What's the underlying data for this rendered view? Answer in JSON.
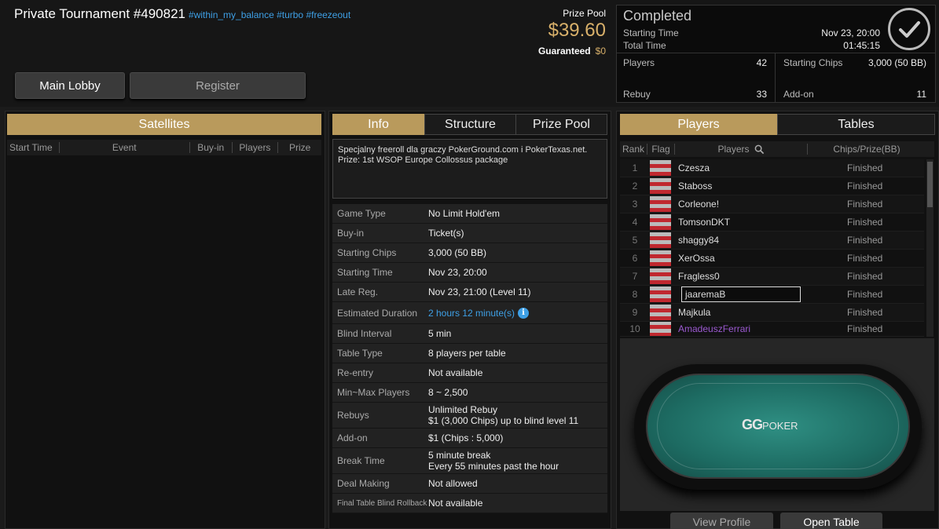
{
  "header": {
    "title": "Private Tournament #490821",
    "tags": "#within_my_balance #turbo #freezeout",
    "prize_pool_label": "Prize Pool",
    "prize_pool_value": "$39.60",
    "guaranteed_label": "Guaranteed",
    "guaranteed_value": "$0",
    "main_lobby_label": "Main Lobby",
    "register_label": "Register"
  },
  "status": {
    "state": "Completed",
    "starting_time_label": "Starting Time",
    "starting_time_value": "Nov 23, 20:00",
    "total_time_label": "Total Time",
    "total_time_value": "01:45:15",
    "players_label": "Players",
    "players_value": "42",
    "rebuy_label": "Rebuy",
    "rebuy_value": "33",
    "starting_chips_label": "Starting Chips",
    "starting_chips_value": "3,000 (50 BB)",
    "addon_label": "Add-on",
    "addon_value": "11"
  },
  "satellites": {
    "tab": "Satellites",
    "columns": [
      "Start Time",
      "Event",
      "Buy-in",
      "Players",
      "Prize"
    ]
  },
  "info_panel": {
    "tabs": [
      "Info",
      "Structure",
      "Prize Pool"
    ],
    "description": "Specjalny freeroll dla graczy PokerGround.com i PokerTexas.net.\nPrize: 1st WSOP Europe Collossus package",
    "rows": [
      {
        "k": "Game Type",
        "v": "No Limit Hold'em"
      },
      {
        "k": "Buy-in",
        "v": "Ticket(s)"
      },
      {
        "k": "Starting Chips",
        "v": "3,000 (50 BB)"
      },
      {
        "k": "Starting Time",
        "v": "Nov 23, 20:00"
      },
      {
        "k": "Late Reg.",
        "v": "Nov 23, 21:00 (Level 11)"
      },
      {
        "k": "Estimated Duration",
        "v": "2 hours 12 minute(s)"
      },
      {
        "k": "Blind Interval",
        "v": "5 min"
      },
      {
        "k": "Table Type",
        "v": "8 players per table"
      },
      {
        "k": "Re-entry",
        "v": "Not available"
      },
      {
        "k": "Min~Max Players",
        "v": "8 ~ 2,500"
      },
      {
        "k": "Rebuys",
        "v": "Unlimited Rebuy\n$1 (3,000 Chips) up to blind level 11"
      },
      {
        "k": "Add-on",
        "v": "$1 (Chips : 5,000)"
      },
      {
        "k": "Break Time",
        "v": "5 minute break\nEvery 55 minutes past the hour"
      },
      {
        "k": "Deal Making",
        "v": "Not allowed"
      },
      {
        "k": "Final Table Blind Rollback",
        "v": "Not available"
      }
    ]
  },
  "players_panel": {
    "tabs": [
      "Players",
      "Tables"
    ],
    "columns": [
      "Rank",
      "Flag",
      "Players",
      "Chips/Prize(BB)"
    ],
    "rows": [
      {
        "rank": "1",
        "name": "Czesza",
        "status": "Finished"
      },
      {
        "rank": "2",
        "name": "Staboss",
        "status": "Finished"
      },
      {
        "rank": "3",
        "name": "Corleone!",
        "status": "Finished"
      },
      {
        "rank": "4",
        "name": "TomsonDKT",
        "status": "Finished"
      },
      {
        "rank": "5",
        "name": "shaggy84",
        "status": "Finished"
      },
      {
        "rank": "6",
        "name": "XerOssa",
        "status": "Finished"
      },
      {
        "rank": "7",
        "name": "Fragless0",
        "status": "Finished"
      },
      {
        "rank": "8",
        "name": "jaaremaB",
        "status": "Finished"
      },
      {
        "rank": "9",
        "name": "Majkula",
        "status": "Finished"
      },
      {
        "rank": "10",
        "name": "AmadeuszFerrari",
        "status": "Finished"
      }
    ],
    "logo_text": "GG",
    "logo_sub": "POKER",
    "view_profile_label": "View Profile",
    "open_table_label": "Open Table"
  },
  "colors": {
    "accent": "#b99a5c",
    "link": "#3ea0e6",
    "prize": "#d8b06a",
    "highlight_name": "#9b59d0"
  }
}
